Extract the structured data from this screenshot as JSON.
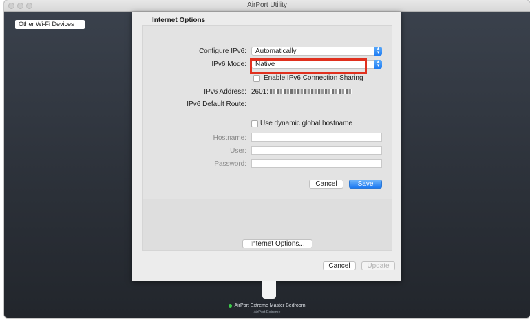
{
  "window": {
    "title": "AirPort Utility"
  },
  "chip": {
    "label": "Other Wi-Fi Devices"
  },
  "sheet": {
    "section_title": "Internet Options",
    "configure_ipv6": {
      "label": "Configure IPv6:",
      "value": "Automatically"
    },
    "ipv6_mode": {
      "label": "IPv6 Mode:",
      "value": "Native"
    },
    "connection_sharing": {
      "label": "Enable IPv6 Connection Sharing",
      "checked": false
    },
    "ipv6_address": {
      "label": "IPv6 Address:",
      "value": "2601:"
    },
    "default_route": {
      "label": "IPv6 Default Route:"
    },
    "dynamic_hostname": {
      "label": "Use dynamic global hostname",
      "checked": false
    },
    "hostname": {
      "label": "Hostname:"
    },
    "user": {
      "label": "User:"
    },
    "password": {
      "label": "Password:"
    },
    "inner_cancel": "Cancel",
    "inner_save": "Save",
    "internet_options_button": "Internet Options...",
    "outer_cancel": "Cancel",
    "outer_update": "Update"
  },
  "device": {
    "name": "AirPort Extreme Master Bedroom",
    "model": "AirPort Extreme",
    "status_color": "#3ccc4a"
  },
  "colors": {
    "accent": "#1d7af2",
    "highlight": "#e0301e"
  }
}
